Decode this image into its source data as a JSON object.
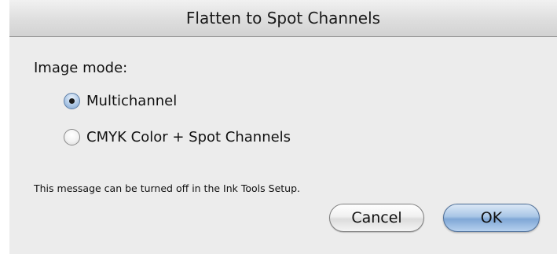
{
  "dialog": {
    "title": "Flatten to Spot Channels",
    "image_mode_label": "Image mode:",
    "options": [
      {
        "label": "Multichannel",
        "selected": true
      },
      {
        "label": "CMYK Color + Spot Channels",
        "selected": false
      }
    ],
    "message": "This message can be turned off in the Ink Tools Setup.",
    "buttons": {
      "cancel_label": "Cancel",
      "ok_label": "OK"
    }
  }
}
